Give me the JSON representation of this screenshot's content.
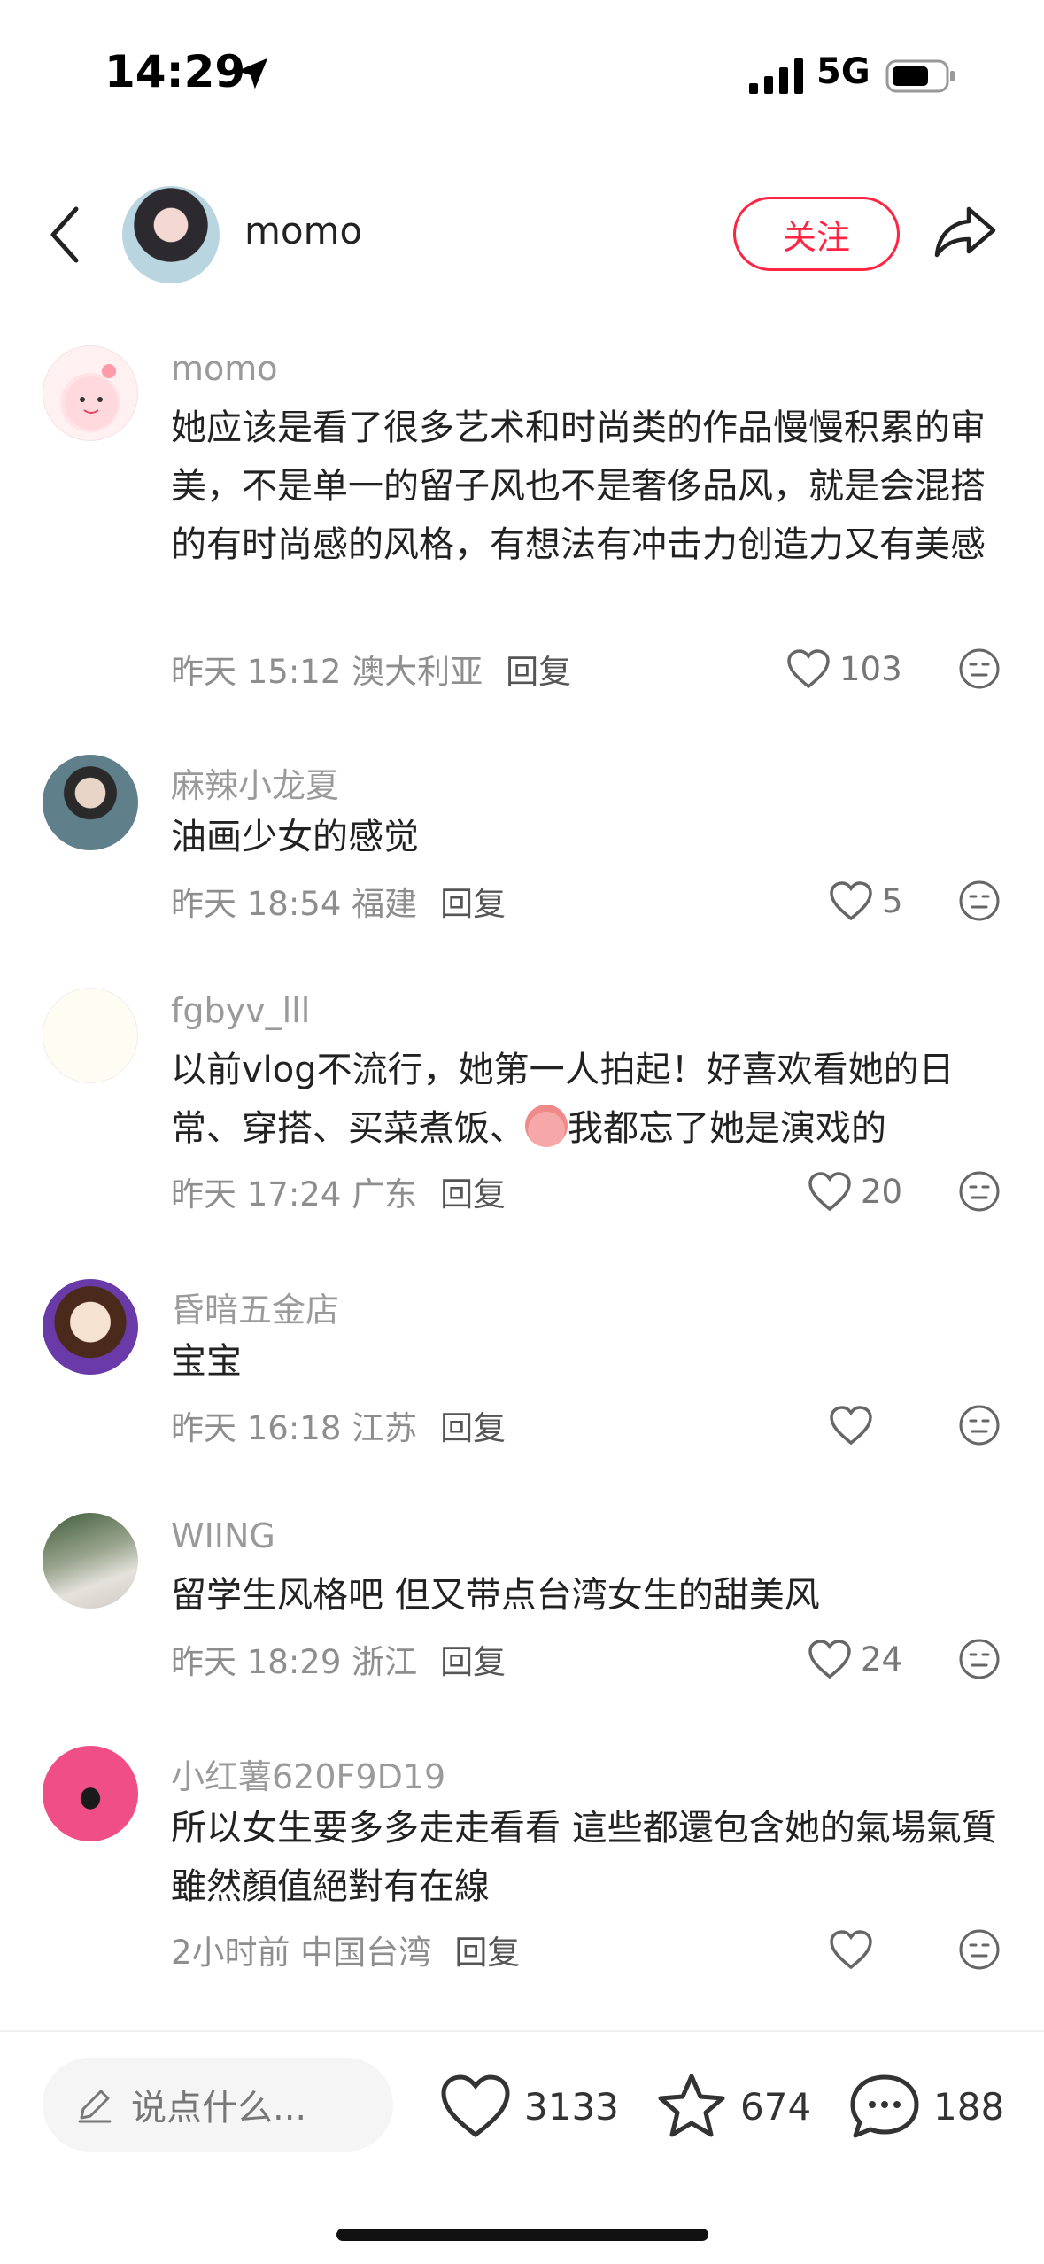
{
  "status_bar": {
    "time": "14:29",
    "network": "5G"
  },
  "header": {
    "name": "momo",
    "follow_label": "关注"
  },
  "comments": [
    {
      "user": "momo",
      "text": "她应该是看了很多艺术和时尚类的作品慢慢积累的审美，不是单一的留子风也不是奢侈品风，就是会混搭的有时尚感的风格，有想法有冲击力创造力又有美感",
      "meta": "昨天 15:12 澳大利亚",
      "reply": "回复",
      "likes": "103"
    },
    {
      "user": "麻辣小龙夏",
      "text": "油画少女的感觉",
      "meta": "昨天 18:54 福建",
      "reply": "回复",
      "likes": "5"
    },
    {
      "user": "fgbyv_lll",
      "text_before": "以前vlog不流行，她第一人拍起！好喜欢看她的日常、穿搭、买菜煮饭、",
      "text_after": "我都忘了她是演戏的",
      "meta": "昨天 17:24 广东",
      "reply": "回复",
      "likes": "20"
    },
    {
      "user": "昏暗五金店",
      "text": "宝宝",
      "meta": "昨天 16:18 江苏",
      "reply": "回复",
      "likes": ""
    },
    {
      "user": "WIING",
      "text": "留学生风格吧 但又带点台湾女生的甜美风",
      "meta": "昨天 18:29 浙江",
      "reply": "回复",
      "likes": "24"
    },
    {
      "user": "小红薯620F9D19",
      "text": "所以女生要多多走走看看 這些都還包含她的氣場氣質 雖然顏值絕對有在線",
      "meta": "2小时前 中国台湾",
      "reply": "回复",
      "likes": ""
    }
  ],
  "bottom_bar": {
    "placeholder": "说点什么...",
    "likes": "3133",
    "favorites": "674",
    "comments": "188"
  },
  "colors": {
    "accent": "#ff2442",
    "secondary_text": "#9a9a9a"
  },
  "icons": [
    "location-arrow-icon",
    "signal-icon",
    "battery-icon",
    "back-icon",
    "share-icon",
    "heart-icon",
    "emoji-icon",
    "pencil-icon",
    "star-icon",
    "comment-bubble-icon"
  ]
}
